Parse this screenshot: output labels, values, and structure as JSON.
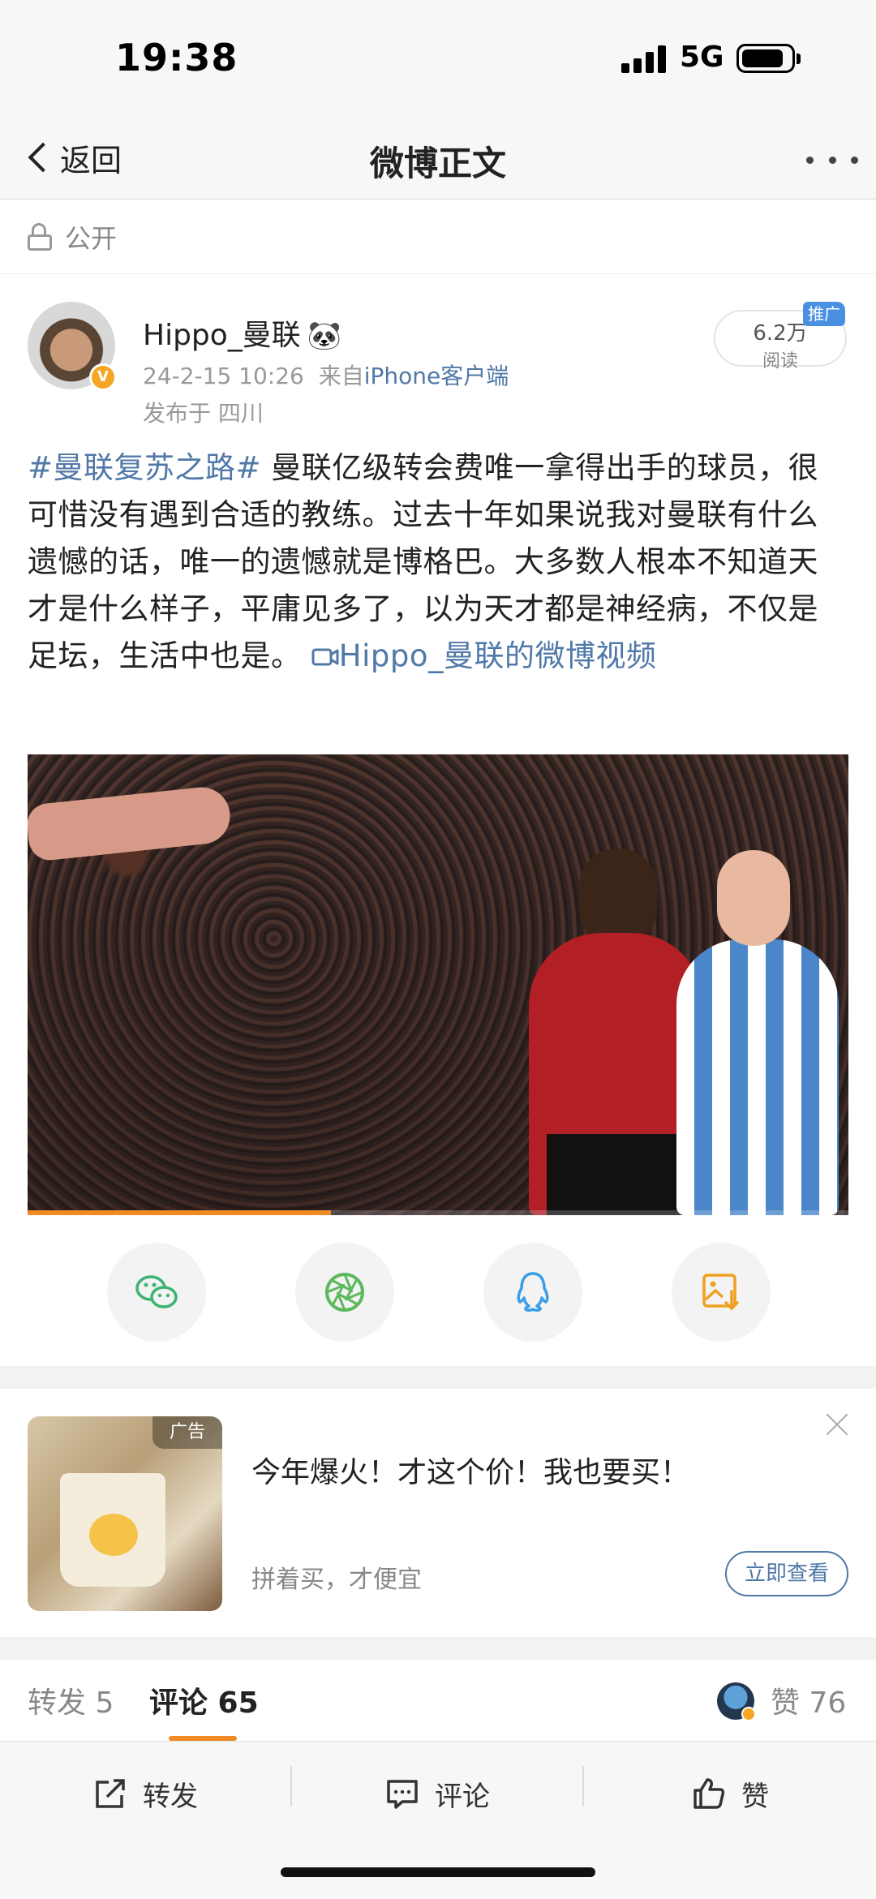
{
  "status_bar": {
    "time": "19:38",
    "network": "5G",
    "signal_icon": "signal-bars-icon",
    "battery_icon": "battery-icon"
  },
  "nav": {
    "back_label": "返回",
    "title": "微博正文",
    "more_icon": "more-dots-icon"
  },
  "visibility": {
    "label": "公开",
    "icon": "unlock-icon"
  },
  "author": {
    "name": "Hippo_曼联",
    "emoji": "🐼",
    "date": "24-2-15 10:26",
    "source_prefix": "来自",
    "source": "iPhone客户端",
    "location": "发布于 四川",
    "verified_mark": "V"
  },
  "read": {
    "count": "6.2万",
    "label": "阅读",
    "promo_tag": "推广"
  },
  "post": {
    "topic": "#曼联复苏之路#",
    "body": " 曼联亿级转会费唯一拿得出手的球员，很可惜没有遇到合适的教练。过去十年如果说我对曼联有什么遗憾的话，唯一的遗憾就是博格巴。大多数人根本不知道天才是什么样子，平庸见多了，以为天才都是神经病，不仅是足坛，生活中也是。",
    "video_link": "Hippo_曼联的微博视频",
    "video_link_icon": "video-camera-icon"
  },
  "video": {
    "progress": 0.37,
    "progress_color": "#f08a24"
  },
  "share_targets": [
    {
      "name": "wechat",
      "icon": "wechat-icon",
      "color": "#3cb371"
    },
    {
      "name": "moments",
      "icon": "wechat-moments-icon",
      "color": "#5cb85c"
    },
    {
      "name": "qq",
      "icon": "qq-icon",
      "color": "#3a9ee8"
    },
    {
      "name": "save-image",
      "icon": "save-image-icon",
      "color": "#f0a020"
    }
  ],
  "ad": {
    "tag": "广告",
    "title": "今年爆火！才这个价！我也要买！",
    "subtitle": "拼着买，才便宜",
    "cta": "立即查看",
    "close_icon": "close-icon"
  },
  "tabs": {
    "repost": "转发 5",
    "comments": "评论 65",
    "likes": "赞 76"
  },
  "actions": {
    "repost": "转发",
    "comment": "评论",
    "like": "赞"
  },
  "colors": {
    "link": "#5078a8",
    "accent": "#f08a24",
    "badge": "#4a90e2"
  }
}
